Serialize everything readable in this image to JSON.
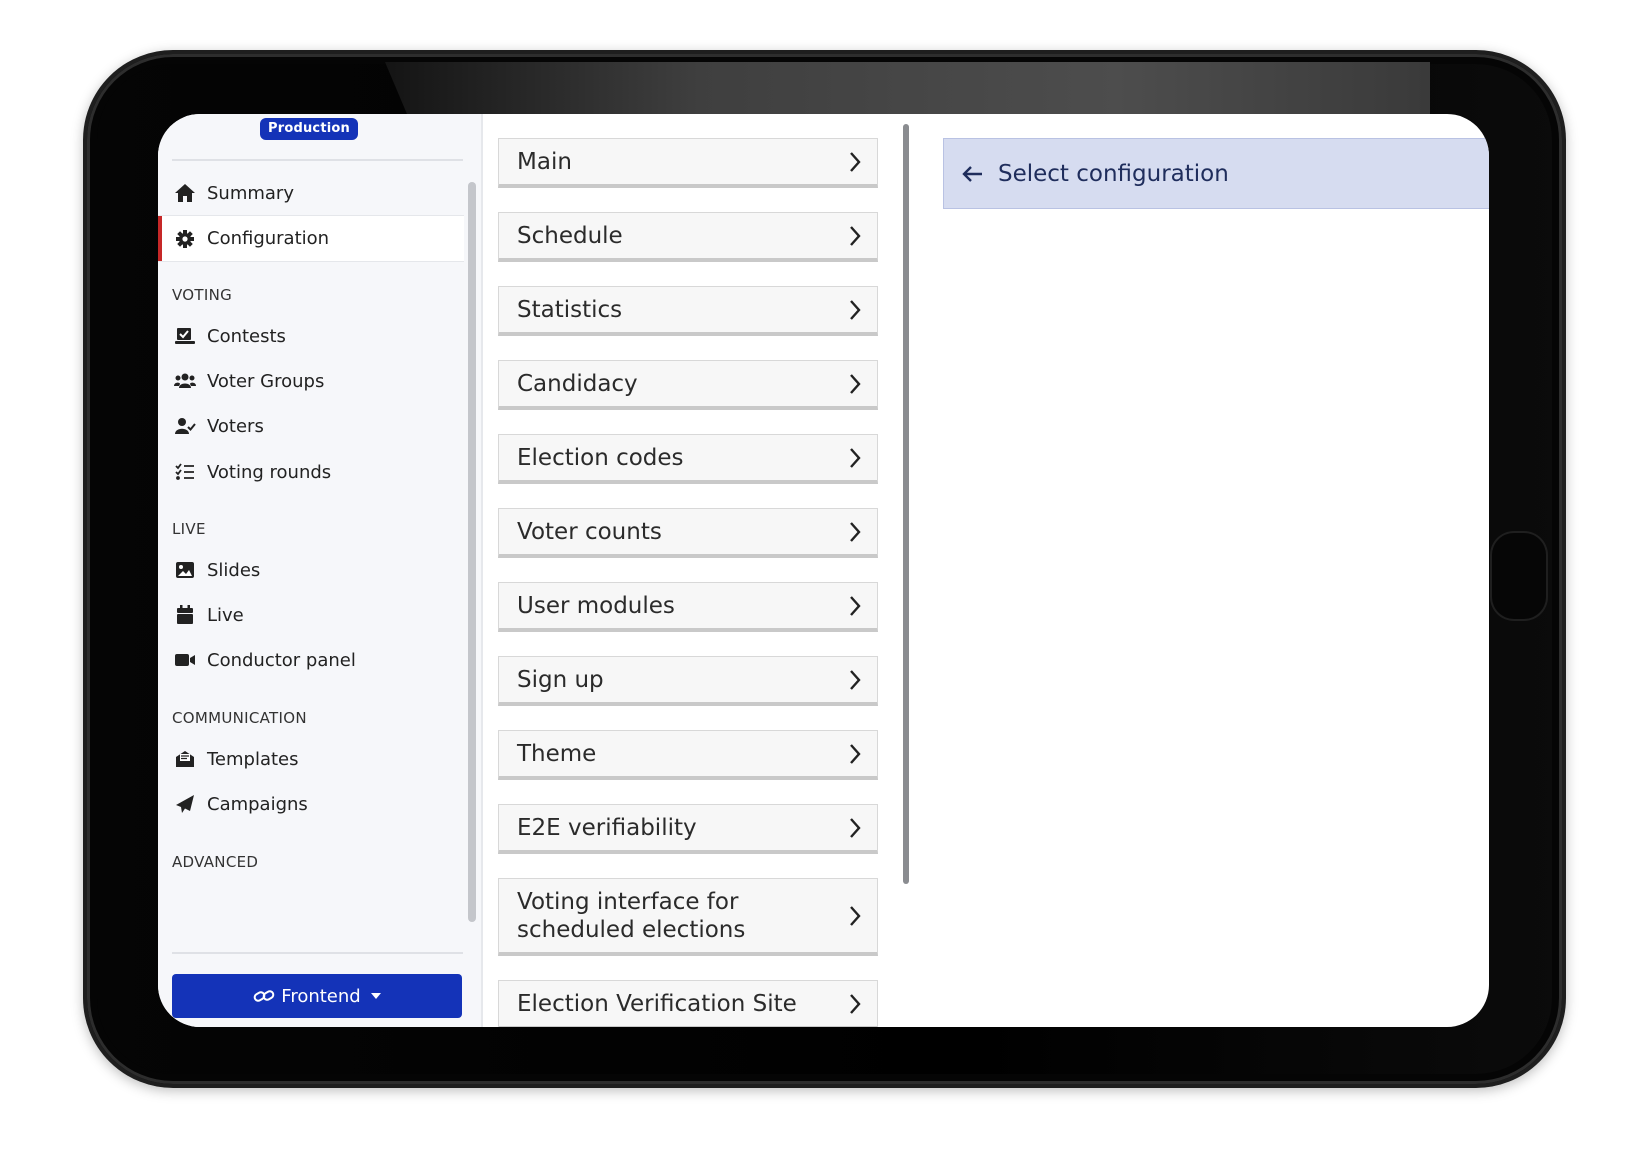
{
  "environment": {
    "badge": "Production"
  },
  "sidebar": {
    "summary": "Summary",
    "configuration": "Configuration",
    "sections": {
      "voting": "VOTING",
      "live": "LIVE",
      "communication": "COMMUNICATION",
      "advanced": "ADVANCED"
    },
    "voting_items": [
      "Contests",
      "Voter Groups",
      "Voters",
      "Voting rounds"
    ],
    "live_items": [
      "Slides",
      "Live",
      "Conductor panel"
    ],
    "communication_items": [
      "Templates",
      "Campaigns"
    ],
    "frontend_button": "Frontend"
  },
  "config_list": [
    "Main",
    "Schedule",
    "Statistics",
    "Candidacy",
    "Election codes",
    "Voter counts",
    "User modules",
    "Sign up",
    "Theme",
    "E2E verifiability",
    "Voting interface for scheduled elections",
    "Election Verification Site"
  ],
  "right_panel": {
    "title": "Select configuration"
  },
  "icons": {
    "summary": "home-icon",
    "configuration": "gear-icon",
    "contests": "ballot-icon",
    "voter_groups": "users-icon",
    "voters": "user-check-icon",
    "voting_rounds": "list-check-icon",
    "slides": "image-icon",
    "live": "calendar-icon",
    "conductor_panel": "video-icon",
    "templates": "envelope-icon",
    "campaigns": "paper-plane-icon",
    "frontend": "link-icon",
    "back": "arrow-left-icon",
    "chevron": "chevron-right-icon"
  },
  "colors": {
    "primary": "#1433b8",
    "active_marker": "#c62828",
    "panel_bg": "#d6dcf0",
    "sidebar_bg": "#f6f7fa"
  }
}
